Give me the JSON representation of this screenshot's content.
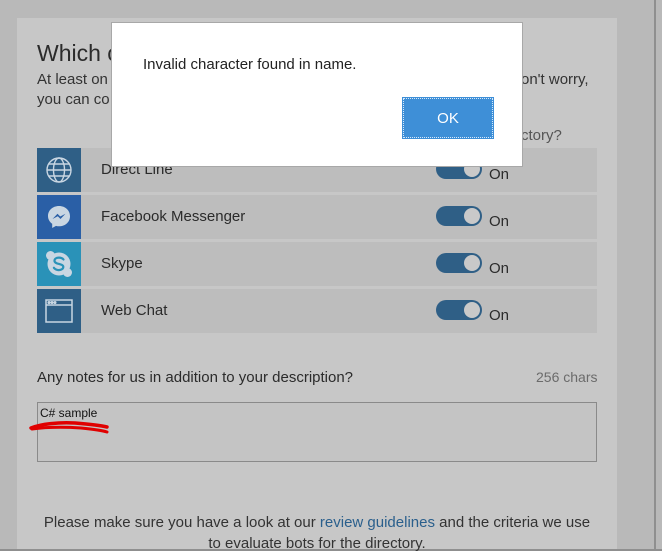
{
  "page": {
    "heading": "Which c",
    "intro_line1": "At least on",
    "intro_line2": "you can co",
    "intro_right": "on't worry,",
    "directory_question": "ctory?"
  },
  "channels": [
    {
      "name": "Direct Line",
      "icon": "globe-icon",
      "toggle_state": "On",
      "icon_bg": "#2f5f86"
    },
    {
      "name": "Facebook Messenger",
      "icon": "messenger-icon",
      "toggle_state": "On",
      "icon_bg": "#2a5fa6"
    },
    {
      "name": "Skype",
      "icon": "skype-icon",
      "toggle_state": "On",
      "icon_bg": "#2a92b8"
    },
    {
      "name": "Web Chat",
      "icon": "webchat-icon",
      "toggle_state": "On",
      "icon_bg": "#2f5f86"
    }
  ],
  "notes": {
    "label": "Any notes for us in addition to your description?",
    "char_count": "256 chars",
    "value": "C# sample"
  },
  "footer": {
    "line1_pre": "Please make sure you have a look at our ",
    "line1_link": "review guidelines",
    "line1_post": " and the criteria we use",
    "line2": "to evaluate bots for the directory."
  },
  "dialog": {
    "message": "Invalid character found in name.",
    "ok_label": "OK"
  },
  "colors": {
    "accent": "#3e8fd7",
    "toggle_on": "#2f5f86",
    "annotation_red": "#e00000"
  }
}
